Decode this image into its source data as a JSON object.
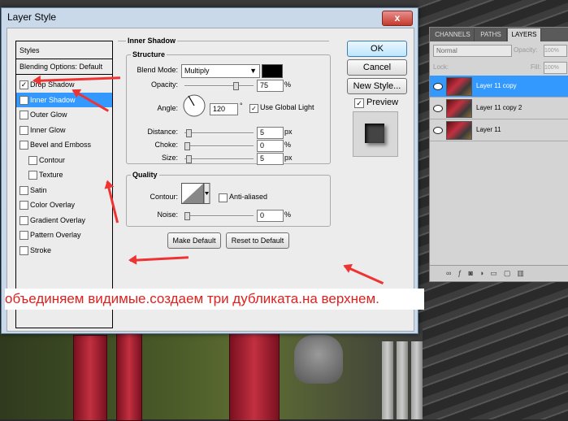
{
  "dialog": {
    "title": "Layer Style",
    "close_glyph": "x",
    "left_list": {
      "header": "Styles",
      "blending": "Blending Options: Default",
      "items": [
        {
          "label": "Drop Shadow",
          "checked": true,
          "selected": false,
          "indent": false
        },
        {
          "label": "Inner Shadow",
          "checked": true,
          "selected": true,
          "indent": false
        },
        {
          "label": "Outer Glow",
          "checked": false,
          "selected": false,
          "indent": false
        },
        {
          "label": "Inner Glow",
          "checked": false,
          "selected": false,
          "indent": false
        },
        {
          "label": "Bevel and Emboss",
          "checked": false,
          "selected": false,
          "indent": false
        },
        {
          "label": "Contour",
          "checked": false,
          "selected": false,
          "indent": true
        },
        {
          "label": "Texture",
          "checked": false,
          "selected": false,
          "indent": true
        },
        {
          "label": "Satin",
          "checked": false,
          "selected": false,
          "indent": false
        },
        {
          "label": "Color Overlay",
          "checked": false,
          "selected": false,
          "indent": false
        },
        {
          "label": "Gradient Overlay",
          "checked": false,
          "selected": false,
          "indent": false
        },
        {
          "label": "Pattern Overlay",
          "checked": false,
          "selected": false,
          "indent": false
        },
        {
          "label": "Stroke",
          "checked": false,
          "selected": false,
          "indent": false
        }
      ]
    },
    "section_title": "Inner Shadow",
    "structure": {
      "title": "Structure",
      "blend_mode_label": "Blend Mode:",
      "blend_mode_value": "Multiply",
      "opacity_label": "Opacity:",
      "opacity_value": "75",
      "opacity_unit": "%",
      "angle_label": "Angle:",
      "angle_value": "120",
      "angle_unit": "°",
      "use_global_light": "Use Global Light",
      "distance_label": "Distance:",
      "distance_value": "5",
      "distance_unit": "px",
      "choke_label": "Choke:",
      "choke_value": "0",
      "choke_unit": "%",
      "size_label": "Size:",
      "size_value": "5",
      "size_unit": "px"
    },
    "quality": {
      "title": "Quality",
      "contour_label": "Contour:",
      "anti_aliased": "Anti-aliased",
      "noise_label": "Noise:",
      "noise_value": "0",
      "noise_unit": "%"
    },
    "make_default": "Make Default",
    "reset_default": "Reset to Default",
    "buttons": {
      "ok": "OK",
      "cancel": "Cancel",
      "new_style": "New Style...",
      "preview": "Preview"
    }
  },
  "layers_panel": {
    "tabs": [
      "CHANNELS",
      "PATHS",
      "LAYERS"
    ],
    "blend": "Normal",
    "opacity_label": "Opacity:",
    "opacity_value": "100%",
    "lock_label": "Lock:",
    "fill_label": "Fill:",
    "fill_value": "100%",
    "layers": [
      {
        "name": "Layer 11 copy",
        "active": true
      },
      {
        "name": "Layer 11 copy 2",
        "active": false
      },
      {
        "name": "Layer 11",
        "active": false
      }
    ]
  },
  "caption": "объединяем видимые.создаем три дубликата.на верхнем.",
  "colors": {
    "accent": "#3399ff",
    "caption_text": "#e0201e",
    "arrow": "#e33333"
  }
}
